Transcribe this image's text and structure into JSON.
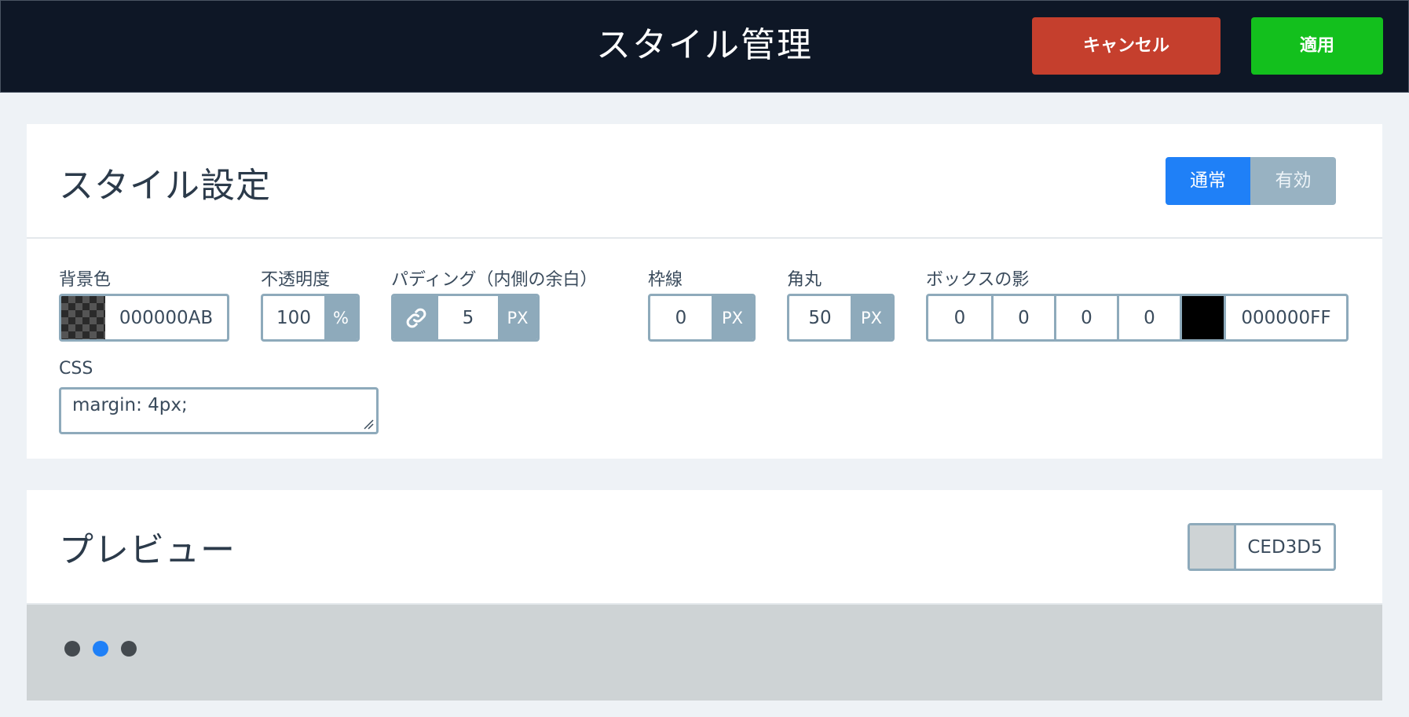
{
  "header": {
    "title": "スタイル管理",
    "cancel_label": "キャンセル",
    "apply_label": "適用"
  },
  "style_card": {
    "title": "スタイル設定",
    "toggle": {
      "normal": "通常",
      "active": "有効",
      "selected": "通常"
    },
    "background": {
      "label": "背景色",
      "value": "000000AB"
    },
    "opacity": {
      "label": "不透明度",
      "value": "100",
      "unit": "%"
    },
    "padding": {
      "label": "パディング（内側の余白）",
      "value": "5",
      "unit": "PX",
      "link_icon": "link-icon"
    },
    "border": {
      "label": "枠線",
      "value": "0",
      "unit": "PX"
    },
    "radius": {
      "label": "角丸",
      "value": "50",
      "unit": "PX"
    },
    "shadow": {
      "label": "ボックスの影",
      "values": [
        "0",
        "0",
        "0",
        "0"
      ],
      "color": "000000FF",
      "swatch": "#000000"
    },
    "css": {
      "label": "CSS",
      "value": "margin: 4px;"
    }
  },
  "preview_card": {
    "title": "プレビュー",
    "color": {
      "value": "CED3D5",
      "swatch": "#CED3D5"
    },
    "dots": {
      "count": 3,
      "active_index": 1
    }
  },
  "colors": {
    "topbar": "#0e1726",
    "cancel": "#c53f2d",
    "apply": "#13c01d",
    "accent": "#1f80f7",
    "field_border": "#8eaabb"
  }
}
